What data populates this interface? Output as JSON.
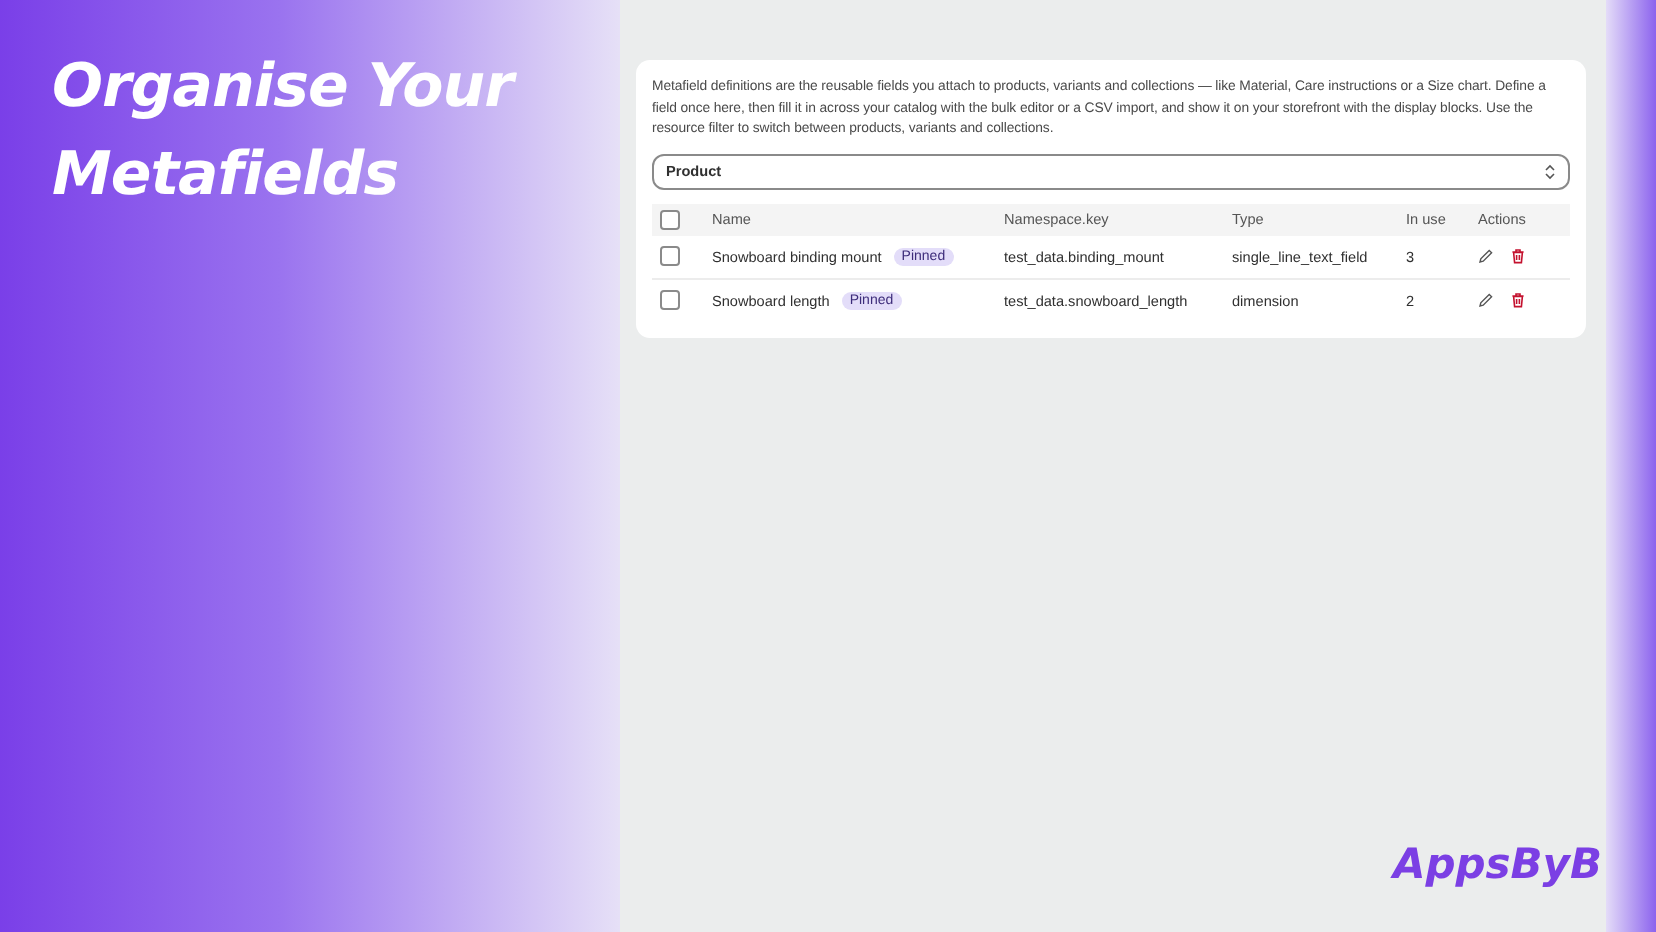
{
  "promo": {
    "headline": "Organise Your Metafields",
    "brand": "AppsByB"
  },
  "card": {
    "description": "Metafield definitions are the reusable fields you attach to products, variants and collections — like Material, Care instructions or a Size chart. Define a field once here, then fill it in across your catalog with the bulk editor or a CSV import, and show it on your storefront with the display blocks. Use the resource filter to switch between products, variants and collections.",
    "resource_filter": {
      "value": "Product"
    },
    "table": {
      "select_all": {
        "checked": false
      },
      "columns": [
        "Name",
        "Namespace.key",
        "Type",
        "In use",
        "Actions"
      ],
      "rows": [
        {
          "checked": false,
          "name": "Snowboard binding mount",
          "badge": "Pinned",
          "key": "test_data.binding_mount",
          "type": "single_line_text_field",
          "in_use": "3"
        },
        {
          "checked": false,
          "name": "Snowboard length",
          "badge": "Pinned",
          "key": "test_data.snowboard_length",
          "type": "dimension",
          "in_use": "2"
        }
      ]
    }
  }
}
